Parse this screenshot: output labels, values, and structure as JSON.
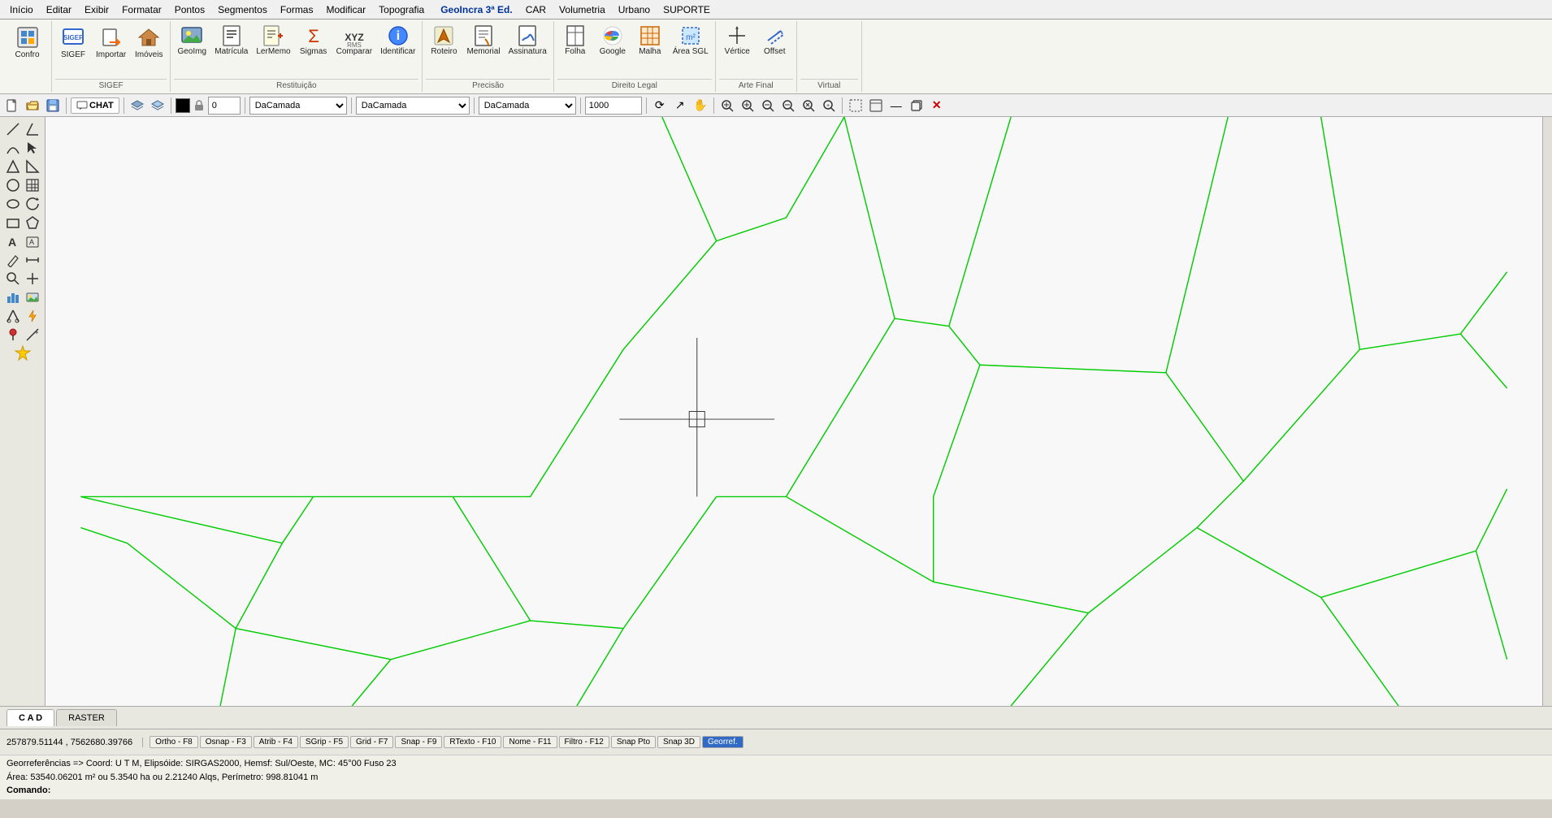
{
  "menubar": {
    "items": [
      "Início",
      "Editar",
      "Exibir",
      "Formatar",
      "Pontos",
      "Segmentos",
      "Formas",
      "Modificar",
      "Topografia",
      "GeoIncra 3ª Ed.",
      "CAR",
      "Volumetria",
      "Urbano",
      "SUPORTE"
    ]
  },
  "ribbon": {
    "groups": [
      {
        "label": "",
        "buttons": [
          {
            "icon": "⚙️",
            "label": "Confro"
          }
        ]
      },
      {
        "label": "SIGEF",
        "buttons": [
          {
            "icon": "📥",
            "label": "Importar"
          },
          {
            "icon": "🏠",
            "label": "Imóveis"
          }
        ]
      },
      {
        "label": "Restituição",
        "buttons": [
          {
            "icon": "🖼️",
            "label": "GeoImg"
          },
          {
            "icon": "📋",
            "label": "Matrícula"
          },
          {
            "icon": "📝",
            "label": "LerMemo"
          },
          {
            "icon": "📊",
            "label": "Sigmas"
          },
          {
            "icon": "📐",
            "label": "Comparar"
          },
          {
            "icon": "🔍",
            "label": "Identificar"
          }
        ]
      },
      {
        "label": "Precisão",
        "buttons": [
          {
            "icon": "🗺️",
            "label": "Roteiro"
          },
          {
            "icon": "📜",
            "label": "Memorial"
          },
          {
            "icon": "✍️",
            "label": "Assinatura"
          }
        ]
      },
      {
        "label": "Direito Legal",
        "buttons": [
          {
            "icon": "📄",
            "label": "Folha"
          },
          {
            "icon": "🌐",
            "label": "Google"
          },
          {
            "icon": "🔲",
            "label": "Malha"
          },
          {
            "icon": "📏",
            "label": "Área SGL"
          }
        ]
      },
      {
        "label": "Arte Final",
        "buttons": [
          {
            "icon": "📍",
            "label": "Vértice"
          },
          {
            "icon": "↔️",
            "label": "Offset"
          }
        ]
      },
      {
        "label": "Virtual",
        "buttons": []
      }
    ]
  },
  "toolbar2": {
    "chat_label": "CHAT",
    "color_value": "0",
    "layer_options": [
      "DaCamada"
    ],
    "linestyle_options": [
      "DaCamada"
    ],
    "thickness_options": [
      "DaCamada"
    ],
    "scale_value": "1000"
  },
  "left_tools": [
    {
      "icon": "╱",
      "label": "line"
    },
    {
      "icon": "╲",
      "label": "angle"
    },
    {
      "icon": "⌒",
      "label": "arc"
    },
    {
      "icon": "🔍",
      "label": "pick"
    },
    {
      "icon": "△",
      "label": "triangle"
    },
    {
      "icon": "⊿",
      "label": "triangle2"
    },
    {
      "icon": "○",
      "label": "circle"
    },
    {
      "icon": "⊞",
      "label": "grid"
    },
    {
      "icon": "●",
      "label": "dot"
    },
    {
      "icon": "↻",
      "label": "rotate"
    },
    {
      "icon": "□",
      "label": "rect"
    },
    {
      "icon": "◇",
      "label": "diamond"
    },
    {
      "icon": "A",
      "label": "text"
    },
    {
      "icon": "⌨",
      "label": "text2"
    },
    {
      "icon": "✏️",
      "label": "pen"
    },
    {
      "icon": "📐",
      "label": "measure"
    },
    {
      "icon": "🔎",
      "label": "zoom"
    },
    {
      "icon": "⊕",
      "label": "add"
    },
    {
      "icon": "📊",
      "label": "chart"
    },
    {
      "icon": "🖼️",
      "label": "image"
    },
    {
      "icon": "✂️",
      "label": "cut"
    },
    {
      "icon": "⚡",
      "label": "lightning"
    },
    {
      "icon": "📌",
      "label": "pin"
    },
    {
      "icon": "✳️",
      "label": "star"
    }
  ],
  "bottom_tabs": [
    {
      "label": "C A D",
      "active": true
    },
    {
      "label": "RASTER",
      "active": false
    }
  ],
  "statusbar": {
    "coords": "257879.51144 , 7562680.39766",
    "buttons": [
      {
        "label": "Ortho - F8",
        "active": false
      },
      {
        "label": "Osnap - F3",
        "active": false
      },
      {
        "label": "Atrib - F4",
        "active": false
      },
      {
        "label": "SGrip - F5",
        "active": false
      },
      {
        "label": "Grid - F7",
        "active": false
      },
      {
        "label": "Snap - F9",
        "active": false
      },
      {
        "label": "RTexto - F10",
        "active": false
      },
      {
        "label": "Nome - F11",
        "active": false
      },
      {
        "label": "Filtro - F12",
        "active": false
      },
      {
        "label": "Snap Pto",
        "active": false
      },
      {
        "label": "Snap 3D",
        "active": false
      },
      {
        "label": "Georref.",
        "active": true
      }
    ]
  },
  "infobar": {
    "line1": "Georreferências => Coord: U T M, Elipsóide: SIRGAS2000, Hemsf: Sul/Oeste, MC: 45°00 Fuso 23",
    "line2": "Área: 53540.06201 m² ou 5.3540 ha ou 2.21240 Alqs, Perímetro: 998.81041 m",
    "line3": "Comando:"
  }
}
